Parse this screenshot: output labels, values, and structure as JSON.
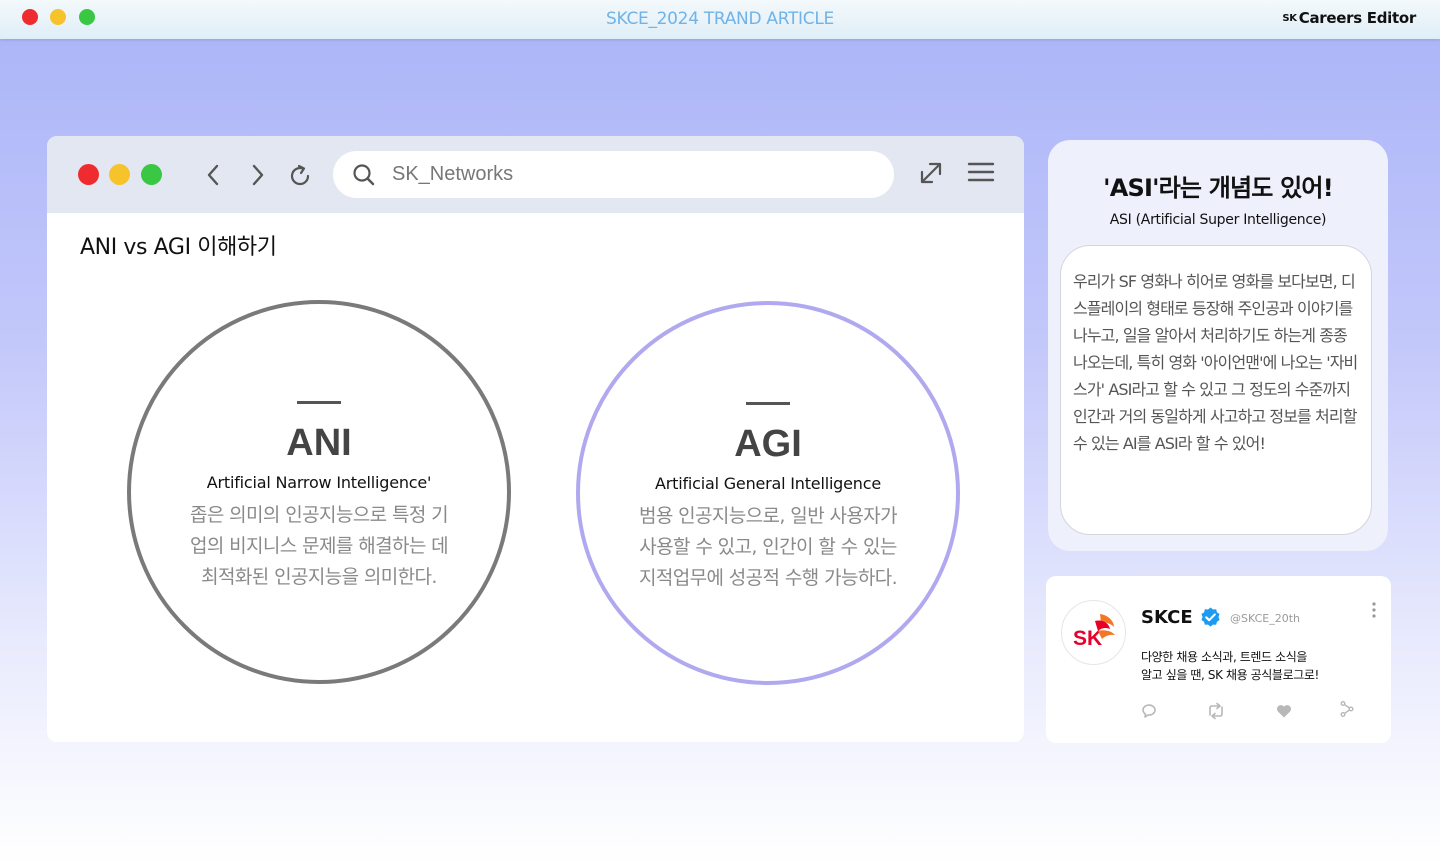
{
  "window": {
    "title": "SKCE_2024 TRAND ARTICLE",
    "brand_prefix": "SK",
    "brand_name": "Careers Editor"
  },
  "browser": {
    "search_value": "SK_Networks",
    "page_heading": "ANI vs AGI 이해하기"
  },
  "circles": {
    "ani": {
      "title": "ANI",
      "subtitle": "Artificial Narrow Intelligence'",
      "description": "좁은 의미의 인공지능으로 특정 기업의 비지니스 문제를 해결하는 데 최적화된 인공지능을 의미한다."
    },
    "agi": {
      "title": "AGI",
      "subtitle": "Artificial General Intelligence",
      "description": "범용 인공지능으로, 일반 사용자가 사용할 수 있고, 인간이 할 수 있는 지적업무에 성공적 수행 가능하다."
    }
  },
  "asi": {
    "title": "'ASI'라는 개념도 있어!",
    "subtitle": "ASI (Artificial Super Intelligence)",
    "body": "우리가 SF 영화나 히어로 영화를 보다보면, 디스플레이의 형태로 등장해 주인공과 이야기를 나누고, 일을 알아서 처리하기도 하는게 종종 나오는데, 특히 영화 '아이언맨'에 나오는 '자비스가' ASI라고 할 수 있고 그 정도의 수준까지 인간과 거의 동일하게 사고하고 정보를 처리할 수 있는 AI를 ASI라 할 수 있어!"
  },
  "tweet": {
    "avatar_text": "SK",
    "name": "SKCE",
    "handle": "@SKCE_20th",
    "body": "다양한 채용 소식과, 트렌드 소식을\n알고 싶을 땐, SK 채용 공식블로그로!"
  },
  "colors": {
    "ani_border": "#7a7a7a",
    "agi_border": "#b1a9ef",
    "title_blue": "#6fb3e8",
    "sk_red": "#e8002a",
    "sk_orange": "#f47725"
  }
}
